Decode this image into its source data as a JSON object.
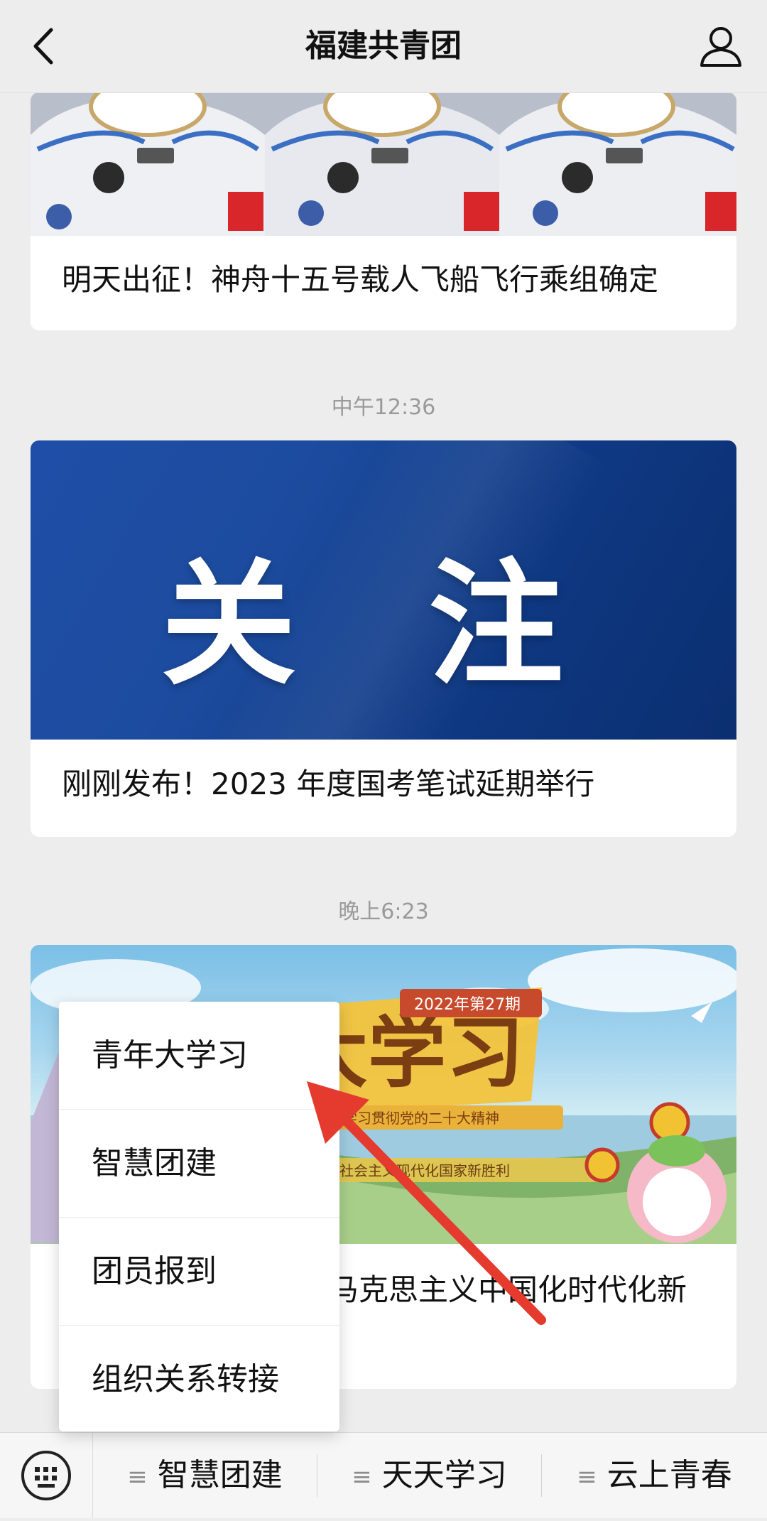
{
  "header": {
    "title": "福建共青团",
    "back_icon": "chevron-left-icon",
    "profile_icon": "user-icon"
  },
  "feed": {
    "articles": [
      {
        "title": "明天出征！神舟十五号载人飞船飞行乘组确定",
        "image": "astronauts-photo"
      },
      {
        "title": "刚刚发布！2023 年度国考笔试延期举行",
        "image_text": "关 注"
      },
      {
        "title": "马克思主义中国化时代化新",
        "image_text": "青年大学习",
        "image_badge": "2022年第27期",
        "image_caption_1": "学习贯彻党的二十大精神",
        "image_caption_2": "建设社会主义现代化国家新胜利"
      }
    ],
    "timestamps": [
      "中午12:36",
      "晚上6:23"
    ]
  },
  "popup_menu": {
    "items": [
      "青年大学习",
      "智慧团建",
      "团员报到",
      "组织关系转接"
    ]
  },
  "bottom_menu": {
    "keyboard_icon": "keyboard-icon",
    "tabs": [
      "智慧团建",
      "天天学习",
      "云上青春"
    ]
  },
  "colors": {
    "background": "#ededed",
    "card": "#ffffff",
    "arrow": "#e53a2e",
    "banner_blue": "#1c4b9e"
  }
}
